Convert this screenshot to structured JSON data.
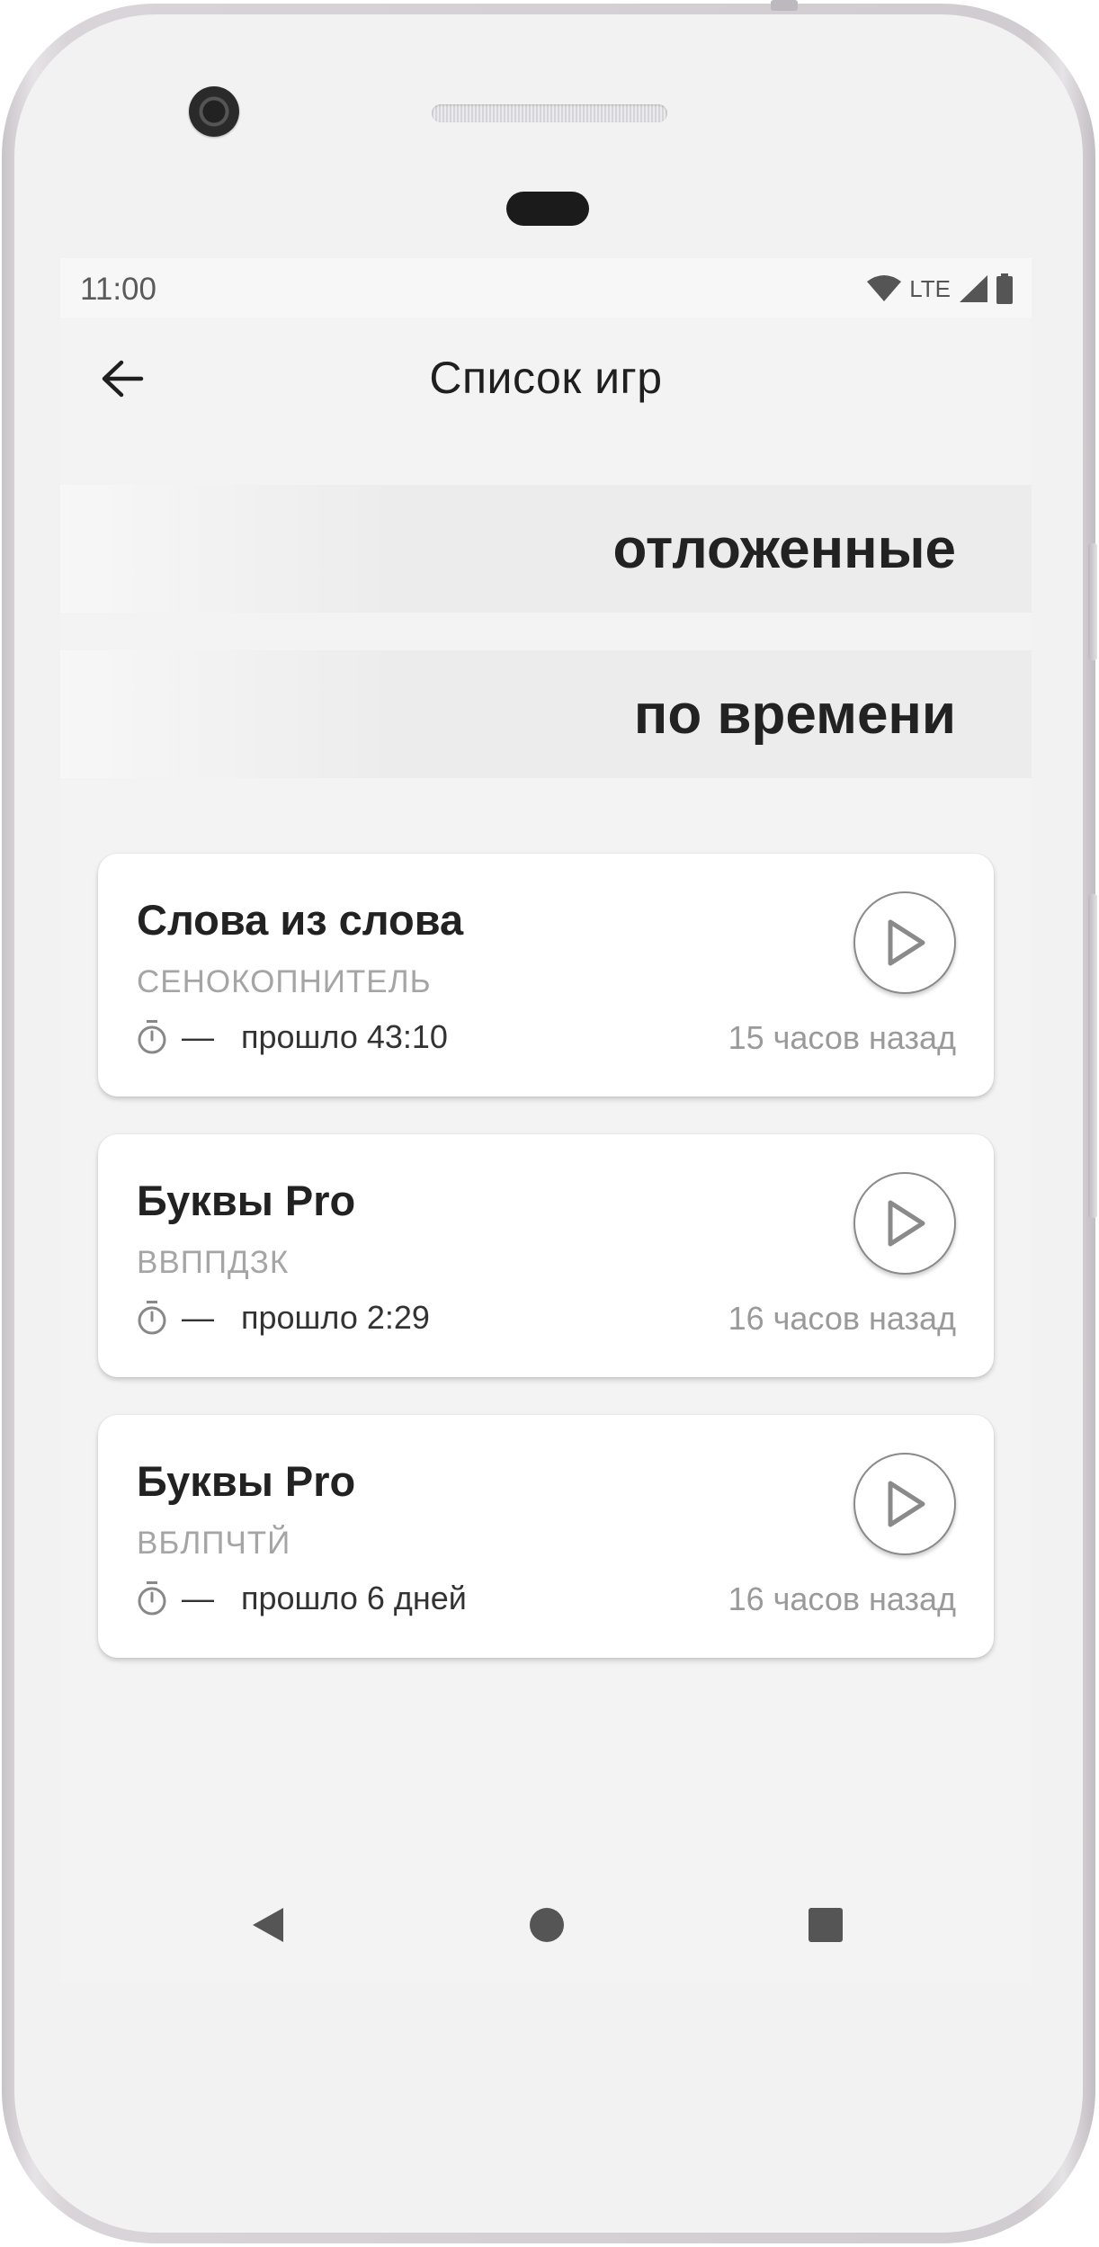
{
  "status_bar": {
    "time": "11:00",
    "network": "LTE",
    "icons": [
      "wifi-icon",
      "signal-icon",
      "battery-icon"
    ]
  },
  "app_bar": {
    "title": "Список игр",
    "back_icon": "arrow-left-icon"
  },
  "filters": [
    {
      "label": "отложенные"
    },
    {
      "label": "по времени"
    }
  ],
  "games": [
    {
      "title": "Слова из слова",
      "word": "СЕНОКОПНИТЕЛЬ",
      "dash": "—",
      "elapsed": "прошло 43:10",
      "ago": "15 часов назад"
    },
    {
      "title": "Буквы Pro",
      "word": "ВВППДЗК",
      "dash": "—",
      "elapsed": "прошло 2:29",
      "ago": "16 часов назад"
    },
    {
      "title": "Буквы Pro",
      "word": "ВБЛПЧТЙ",
      "dash": "—",
      "elapsed": "прошло 6 дней",
      "ago": "16 часов назад"
    }
  ],
  "nav_bar": {
    "icons": [
      "back-triangle-icon",
      "home-circle-icon",
      "recents-square-icon"
    ]
  },
  "colors": {
    "screen_background": "#f3f3f3",
    "card_background": "#ffffff",
    "band_background": "#ececec",
    "muted_text": "#a5a5a5",
    "primary_text": "#222222"
  }
}
